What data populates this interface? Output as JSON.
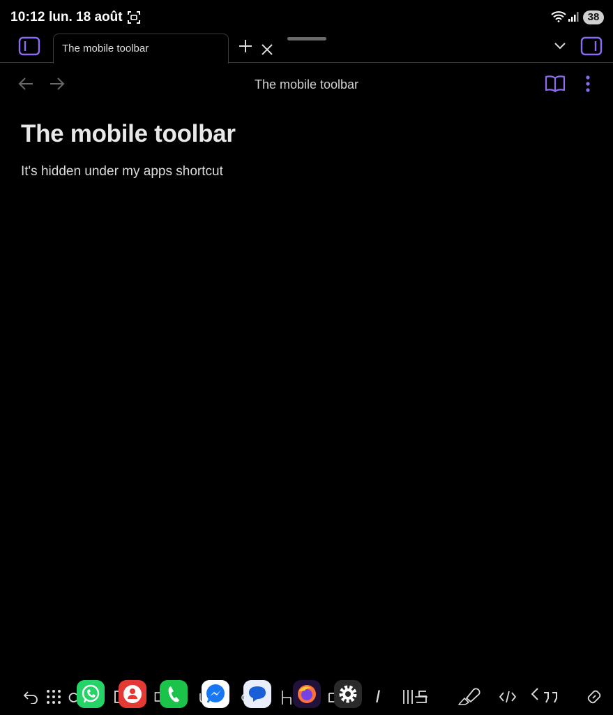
{
  "status_bar": {
    "time": "10:12",
    "date": "lun. 18 août",
    "battery": "38",
    "icons": [
      "screenshot-icon",
      "wifi-6e-icon",
      "signal-icon",
      "battery-icon"
    ]
  },
  "tab_bar": {
    "active_tab_label": "The mobile toolbar",
    "icons": [
      "left-sidebar-icon",
      "close-icon",
      "plus-icon",
      "chevron-down-icon",
      "right-sidebar-icon"
    ]
  },
  "view_header": {
    "title": "The mobile toolbar",
    "icons": [
      "arrow-left-icon",
      "arrow-right-icon",
      "book-open-icon",
      "more-vertical-icon"
    ]
  },
  "note": {
    "title": "The mobile toolbar",
    "body": "It's hidden under my apps shortcut"
  },
  "mobile_toolbar": {
    "icons": [
      "undo-icon",
      "grid-icon",
      "redo-icon",
      "bracket-icon",
      "checkbox-icon",
      "attach-icon",
      "heading-icon",
      "bold-icon",
      "italic-icon",
      "strikethrough-icon",
      "highlight-icon",
      "code-icon",
      "quote-icon",
      "link-icon"
    ],
    "italic_glyph": "I"
  },
  "app_shortcuts": {
    "apps": [
      "whatsapp",
      "contacts",
      "phone",
      "messenger",
      "messages",
      "firefox",
      "settings"
    ]
  },
  "colors": {
    "background": "#000000",
    "accent": "#8b6cf2",
    "text": "#dcdcdc",
    "muted": "#6a6a6a",
    "border": "#3a3a3a"
  }
}
